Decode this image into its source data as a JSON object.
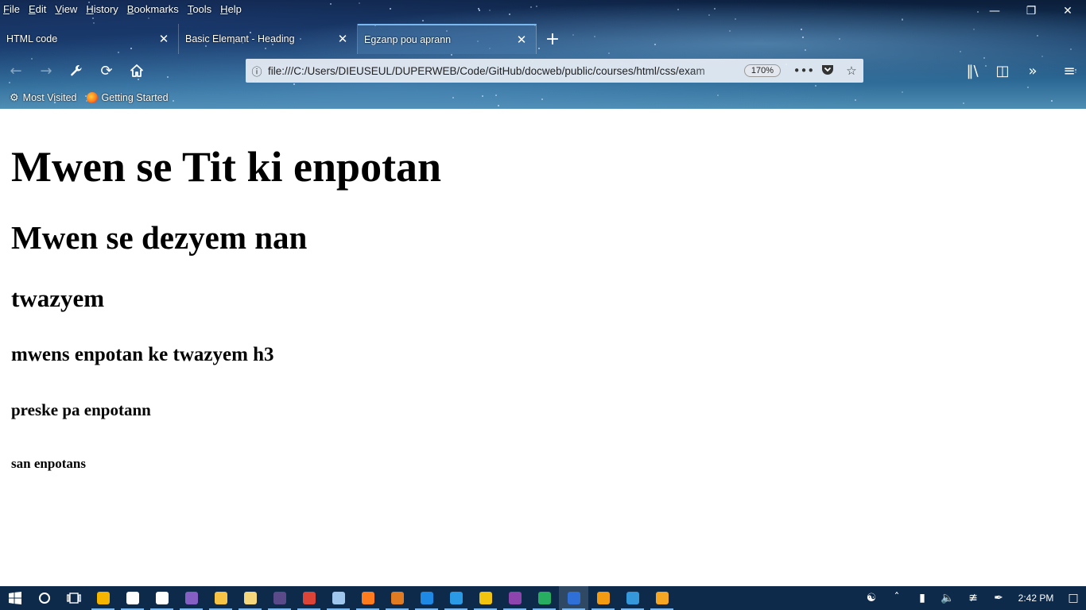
{
  "menu": [
    "File",
    "Edit",
    "View",
    "History",
    "Bookmarks",
    "Tools",
    "Help"
  ],
  "tabs": [
    {
      "title": "HTML code"
    },
    {
      "title": "Basic Elemant - Heading"
    },
    {
      "title": "Egzanp pou aprann"
    }
  ],
  "urlbar": {
    "url": "file:///C:/Users/DIEUSEUL/DUPERWEB/Code/GitHub/docweb/public/courses/html/css/exam",
    "zoom": "170%"
  },
  "bookmarks": [
    {
      "label": "Most Visited",
      "icon": "gear-icon"
    },
    {
      "label": "Getting Started",
      "icon": "firefox-icon"
    }
  ],
  "page": {
    "h1": "Mwen se Tit ki enpotan",
    "h2": "Mwen se dezyem nan",
    "h3": "twazyem",
    "h4": "mwens enpotan ke twazyem h3",
    "h5": "preske pa enpotann",
    "h6": "san enpotans"
  },
  "taskbar": {
    "clock": "2:42 PM",
    "apps": [
      {
        "name": "chrome-canary",
        "color": "#f4b400"
      },
      {
        "name": "mail",
        "color": "#ffffff"
      },
      {
        "name": "store",
        "color": "#ffffff"
      },
      {
        "name": "visual-studio",
        "color": "#865fc5"
      },
      {
        "name": "file-explorer",
        "color": "#f6c344"
      },
      {
        "name": "notes",
        "color": "#f3d77a"
      },
      {
        "name": "jw",
        "color": "#5b4a8a"
      },
      {
        "name": "chrome",
        "color": "#db4437"
      },
      {
        "name": "notepad",
        "color": "#9fc7ee"
      },
      {
        "name": "firefox",
        "color": "#ff7b1c"
      },
      {
        "name": "sublime",
        "color": "#e07b22"
      },
      {
        "name": "edge",
        "color": "#1e88e5"
      },
      {
        "name": "vscode",
        "color": "#2b9ae6"
      },
      {
        "name": "git",
        "color": "#f1c40f"
      },
      {
        "name": "app-purple",
        "color": "#8e44ad"
      },
      {
        "name": "app-green",
        "color": "#27ae60"
      },
      {
        "name": "firefox-dev",
        "color": "#2e6fd8"
      },
      {
        "name": "media",
        "color": "#f39c12"
      },
      {
        "name": "app-blue",
        "color": "#3498db"
      },
      {
        "name": "app-orange",
        "color": "#f5a623"
      }
    ]
  }
}
